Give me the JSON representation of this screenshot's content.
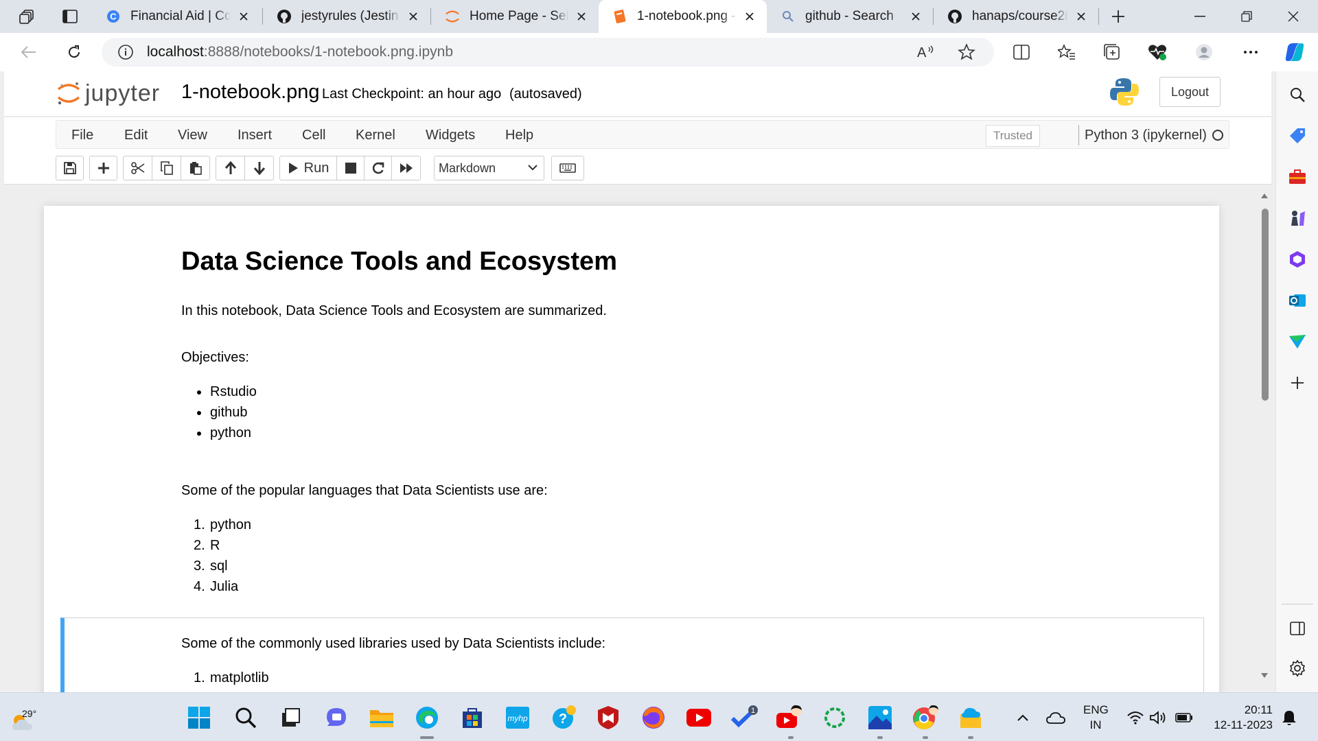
{
  "browser": {
    "tabs": [
      {
        "title": "Financial Aid | Cou",
        "icon": "coursera-icon"
      },
      {
        "title": "jestyrules (Jestin G",
        "icon": "github-icon"
      },
      {
        "title": "Home Page - Selec",
        "icon": "jupyter-icon"
      },
      {
        "title": "1-notebook.png -",
        "icon": "notebook-icon",
        "active": true
      },
      {
        "title": "github - Search",
        "icon": "search-icon"
      },
      {
        "title": "hanaps/course2ibr",
        "icon": "github-icon"
      }
    ],
    "url_host": "localhost",
    "url_path": ":8888/notebooks/1-notebook.png.ipynb",
    "accent": "#f37726"
  },
  "jupyter": {
    "logo_text": "jupyter",
    "notebook_name": "1-notebook.png",
    "checkpoint": "Last Checkpoint: an hour ago",
    "autosave": "(autosaved)",
    "logout_label": "Logout",
    "menus": [
      "File",
      "Edit",
      "View",
      "Insert",
      "Cell",
      "Kernel",
      "Widgets",
      "Help"
    ],
    "trusted_label": "Trusted",
    "kernel_name": "Python 3 (ipykernel)",
    "run_label": "Run",
    "cell_type": "Markdown"
  },
  "notebook": {
    "title": "Data Science Tools and Ecosystem",
    "intro": "In this notebook, Data Science Tools and Ecosystem are summarized.",
    "objectives_label": "Objectives:",
    "objectives": [
      "Rstudio",
      "github",
      "python"
    ],
    "languages_intro": "Some of the popular languages that Data Scientists use are:",
    "languages": [
      "python",
      "R",
      "sql",
      "Julia"
    ],
    "libraries_intro": "Some of the commonly used libraries used by Data Scientists include:",
    "libraries": [
      "matplotlib"
    ],
    "selected_cell_color": "#42a5f5"
  },
  "taskbar": {
    "temperature": "29°",
    "lang_line1": "ENG",
    "lang_line2": "IN",
    "time": "20:11",
    "date": "12-11-2023",
    "badge_count": "1"
  }
}
